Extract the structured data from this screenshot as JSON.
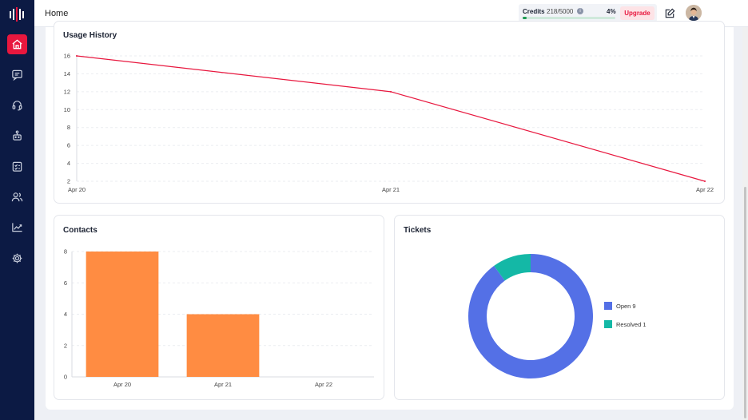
{
  "header": {
    "title": "Home",
    "credits_label": "Credits",
    "credits_count": "218/5000",
    "credits_pct": "4%",
    "credits_progress": 0.04,
    "upgrade_label": "Upgrade"
  },
  "sidebar": {
    "items": [
      {
        "icon": "home-icon",
        "active": true
      },
      {
        "icon": "chat-icon",
        "active": false
      },
      {
        "icon": "headset-icon",
        "active": false
      },
      {
        "icon": "bot-icon",
        "active": false
      },
      {
        "icon": "tasks-icon",
        "active": false
      },
      {
        "icon": "users-icon",
        "active": false
      },
      {
        "icon": "analytics-icon",
        "active": false
      },
      {
        "icon": "settings-icon",
        "active": false
      }
    ]
  },
  "colors": {
    "accent": "#e8173e",
    "sidebar": "#0c1a44",
    "line": "#e8173e",
    "bar": "#ff8c42",
    "open": "#5470e6",
    "resolved": "#14b8a6"
  },
  "usage_card": {
    "title": "Usage History"
  },
  "contacts_card": {
    "title": "Contacts"
  },
  "tickets_card": {
    "title": "Tickets",
    "legend": [
      {
        "label": "Open 9"
      },
      {
        "label": "Resolved 1"
      }
    ]
  },
  "chart_data": [
    {
      "type": "line",
      "title": "Usage History",
      "categories": [
        "Apr 20",
        "Apr 21",
        "Apr 22"
      ],
      "values": [
        16,
        12,
        2
      ],
      "yticks": [
        2,
        4,
        6,
        8,
        10,
        12,
        14,
        16
      ],
      "ylim": [
        2,
        16
      ],
      "grid": true
    },
    {
      "type": "bar",
      "title": "Contacts",
      "categories": [
        "Apr 20",
        "Apr 21",
        "Apr 22"
      ],
      "values": [
        8,
        4,
        0
      ],
      "yticks": [
        0,
        2,
        4,
        6,
        8
      ],
      "ylim": [
        0,
        8
      ],
      "grid": true
    },
    {
      "type": "pie",
      "title": "Tickets",
      "series": [
        {
          "name": "Open",
          "value": 9
        },
        {
          "name": "Resolved",
          "value": 1
        }
      ],
      "legend": "right"
    }
  ]
}
